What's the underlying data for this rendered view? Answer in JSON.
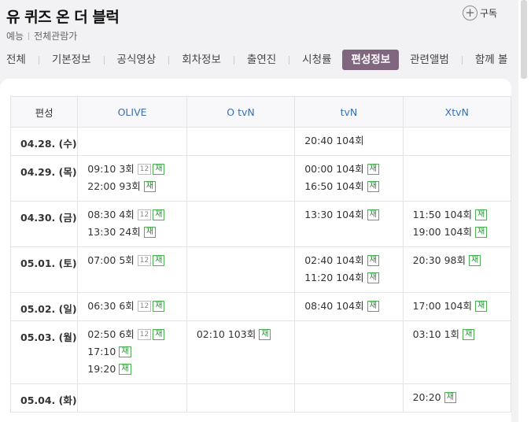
{
  "header": {
    "title": "유 퀴즈 온 더 블럭",
    "genre": "예능",
    "rating": "전체관람가",
    "subscribe_label": "구독"
  },
  "tabs": [
    "전체",
    "기본정보",
    "공식영상",
    "회차정보",
    "출연진",
    "시청률",
    "편성정보",
    "관련앨범",
    "함께 볼"
  ],
  "active_tab": "편성정보",
  "schedule": {
    "corner_label": "편성",
    "channels": [
      "OLIVE",
      "O tvN",
      "tvN",
      "XtvN"
    ],
    "rows": [
      {
        "date": "04.28. (수)",
        "cells": [
          [],
          [],
          [
            {
              "time": "20:40",
              "ep": "104회",
              "age": "",
              "re": ""
            }
          ],
          []
        ]
      },
      {
        "date": "04.29. (목)",
        "cells": [
          [
            {
              "time": "09:10",
              "ep": "3회",
              "age": "12",
              "re": "재"
            },
            {
              "time": "22:00",
              "ep": "93회",
              "age": "",
              "re": "재"
            }
          ],
          [],
          [
            {
              "time": "00:00",
              "ep": "104회",
              "age": "",
              "re": "재"
            },
            {
              "time": "16:50",
              "ep": "104회",
              "age": "",
              "re": "재"
            }
          ],
          []
        ]
      },
      {
        "date": "04.30. (금)",
        "cells": [
          [
            {
              "time": "08:30",
              "ep": "4회",
              "age": "12",
              "re": "재"
            },
            {
              "time": "13:30",
              "ep": "24회",
              "age": "",
              "re": "재"
            }
          ],
          [],
          [
            {
              "time": "13:30",
              "ep": "104회",
              "age": "",
              "re": "재"
            }
          ],
          [
            {
              "time": "11:50",
              "ep": "104회",
              "age": "",
              "re": "재"
            },
            {
              "time": "19:00",
              "ep": "104회",
              "age": "",
              "re": "재"
            }
          ]
        ]
      },
      {
        "date": "05.01. (토)",
        "cells": [
          [
            {
              "time": "07:00",
              "ep": "5회",
              "age": "12",
              "re": "재"
            }
          ],
          [],
          [
            {
              "time": "02:40",
              "ep": "104회",
              "age": "",
              "re": "재"
            },
            {
              "time": "11:20",
              "ep": "104회",
              "age": "",
              "re": "재"
            }
          ],
          [
            {
              "time": "20:30",
              "ep": "98회",
              "age": "",
              "re": "재"
            }
          ]
        ]
      },
      {
        "date": "05.02. (일)",
        "cells": [
          [
            {
              "time": "06:30",
              "ep": "6회",
              "age": "12",
              "re": "재"
            }
          ],
          [],
          [
            {
              "time": "08:40",
              "ep": "104회",
              "age": "",
              "re": "재"
            }
          ],
          [
            {
              "time": "17:00",
              "ep": "104회",
              "age": "",
              "re": "재"
            }
          ]
        ]
      },
      {
        "date": "05.03. (월)",
        "cells": [
          [
            {
              "time": "02:50",
              "ep": "6회",
              "age": "12",
              "re": "재"
            },
            {
              "time": "17:10",
              "ep": "",
              "age": "",
              "re": "재"
            },
            {
              "time": "19:20",
              "ep": "",
              "age": "",
              "re": "재"
            }
          ],
          [
            {
              "time": "02:10",
              "ep": "103회",
              "age": "",
              "re": "재"
            }
          ],
          [],
          [
            {
              "time": "03:10",
              "ep": "1회",
              "age": "",
              "re": "재"
            }
          ]
        ]
      },
      {
        "date": "05.04. (화)",
        "cells": [
          [],
          [],
          [],
          [
            {
              "time": "20:20",
              "ep": "",
              "age": "",
              "re": "재"
            }
          ]
        ]
      }
    ]
  },
  "colors": {
    "active_tab_bg": "#80677f",
    "channel_header_text": "#3a6fb0",
    "rerun_badge": "#2e8b3e"
  },
  "icons": {
    "subscribe": "plus-circle-icon"
  }
}
